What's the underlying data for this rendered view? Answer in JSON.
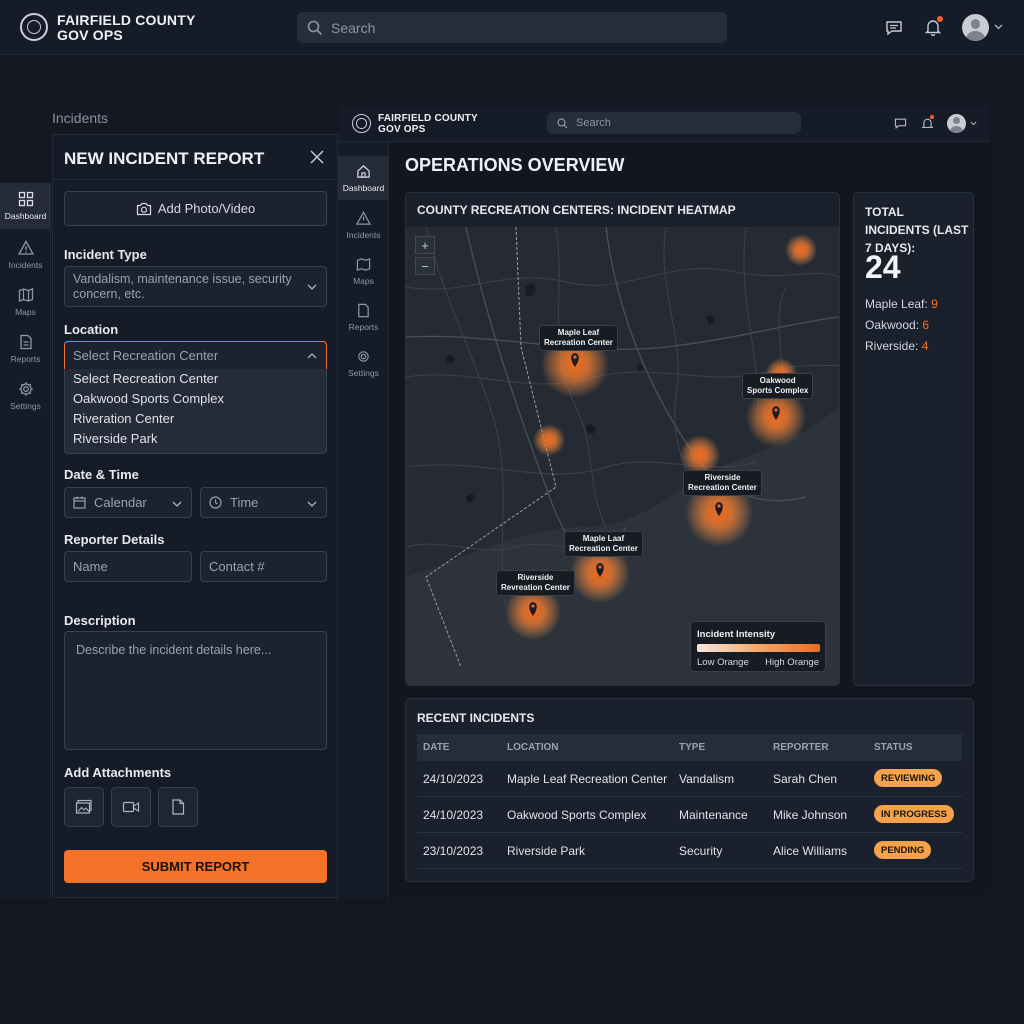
{
  "app": {
    "brand_line1": "FAIRFIELD COUNTY",
    "brand_line2": "GOV OPS"
  },
  "search": {
    "placeholder": "Search"
  },
  "page": {
    "section_label": "Incidents"
  },
  "sidebar": {
    "items": [
      {
        "label": "Dashboard",
        "icon": "dashboard-icon",
        "active": true
      },
      {
        "label": "Incidents",
        "icon": "warning-icon"
      },
      {
        "label": "Maps",
        "icon": "map-icon"
      },
      {
        "label": "Reports",
        "icon": "document-icon"
      },
      {
        "label": "Settings",
        "icon": "gear-icon"
      }
    ]
  },
  "form": {
    "title": "NEW INCIDENT REPORT",
    "add_media_label": "Add Photo/Video",
    "incident_type_label": "Incident Type",
    "incident_type_placeholder": "Vandalism, maintenance issue, security concern, etc.",
    "location_label": "Location",
    "location_selected": "Select Recreation Center",
    "location_options": [
      "Select Recreation Center",
      "Oakwood Sports Complex",
      "Riveration Center",
      "Riverside Park"
    ],
    "datetime_label": "Date & Time",
    "calendar_label": "Calendar",
    "time_label": "Time",
    "reporter_label": "Reporter Details",
    "name_placeholder": "Name",
    "contact_placeholder": "Contact #",
    "description_label": "Description",
    "description_placeholder": "Describe the incident details here...",
    "attachments_label": "Add Attachments",
    "submit_label": "SUBMIT REPORT"
  },
  "dashboard": {
    "title": "OPERATIONS OVERVIEW",
    "map": {
      "title": "COUNTY RECREATION CENTERS: INCIDENT HEATMAP",
      "zoom_in": "+",
      "zoom_out": "−",
      "pins": [
        {
          "line1": "Maple Leaf",
          "line2": "Recreation Center"
        },
        {
          "line1": "Oakwood",
          "line2": "Sports Complex"
        },
        {
          "line1": "Riverside",
          "line2": "Recreation Center"
        },
        {
          "line1": "Maple Laaf",
          "line2": "Recreation Center"
        },
        {
          "line1": "Riverside",
          "line2": "Revreation Center"
        }
      ],
      "legend": {
        "title": "Incident Intensity",
        "low": "Low Orange",
        "high": "High Orange"
      },
      "colors": {
        "heat_core": "#f06a21",
        "heat_glow": "#f59a4f"
      }
    },
    "stats": {
      "title": "TOTAL INCIDENTS (LAST 7 DAYS):",
      "total": "24",
      "rows": [
        {
          "label": "Maple Leaf:",
          "value": "9"
        },
        {
          "label": "Oakwood:",
          "value": "6"
        },
        {
          "label": "Riverside:",
          "value": "4"
        }
      ]
    },
    "recent": {
      "title": "RECENT INCIDENTS",
      "columns": [
        "DATE",
        "LOCATION",
        "TYPE",
        "REPORTER",
        "STATUS"
      ],
      "rows": [
        {
          "date": "24/10/2023",
          "location": "Maple Leaf Recreation Center",
          "type": "Vandalism",
          "reporter": "Sarah Chen",
          "status": "REVIEWING"
        },
        {
          "date": "24/10/2023",
          "location": "Oakwood Sports Complex",
          "type": "Maintenance",
          "reporter": "Mike Johnson",
          "status": "IN PROGRESS"
        },
        {
          "date": "23/10/2023",
          "location": "Riverside Park",
          "type": "Security",
          "reporter": "Alice Williams",
          "status": "PENDING"
        }
      ]
    }
  },
  "theme": {
    "accent": "#f27229",
    "status_badge": "#f4a24c",
    "background": "#131822"
  }
}
